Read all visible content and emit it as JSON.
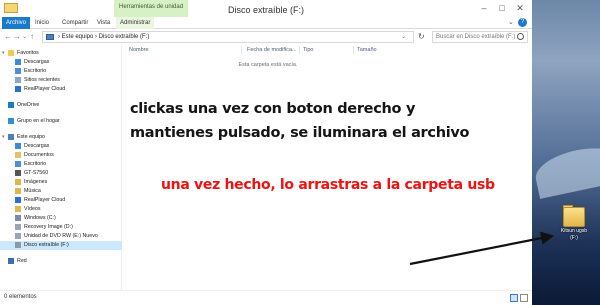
{
  "window": {
    "title": "Disco extraíble (F:)",
    "tools_group_label": "Herramientas de unidad"
  },
  "ribbon": {
    "tabs": [
      {
        "label": "Archivo"
      },
      {
        "label": "Inicio"
      },
      {
        "label": "Compartir"
      },
      {
        "label": "Vista"
      },
      {
        "label": "Administrar"
      }
    ]
  },
  "address": {
    "path": "›  Este equipo  ›  Disco extraíble (F:)",
    "search_placeholder": "Buscar en Disco extraíble (F:)"
  },
  "nav_pane": {
    "groups": [
      {
        "label": "Favoritos",
        "icon": "star-icon",
        "items": [
          {
            "label": "Descargas",
            "icon": "download-folder-icon"
          },
          {
            "label": "Escritorio",
            "icon": "desktop-folder-icon"
          },
          {
            "label": "Sitios recientes",
            "icon": "recent-places-icon"
          },
          {
            "label": "RealPlayer Cloud",
            "icon": "realplayer-icon"
          }
        ]
      },
      {
        "label": "OneDrive",
        "icon": "cloud-icon",
        "items": []
      },
      {
        "label": "Grupo en el hogar",
        "icon": "homegroup-icon",
        "items": []
      },
      {
        "label": "Este equipo",
        "icon": "pc-icon",
        "items": [
          {
            "label": "Descargas",
            "icon": "download-folder-icon"
          },
          {
            "label": "Documentos",
            "icon": "documents-folder-icon"
          },
          {
            "label": "Escritorio",
            "icon": "desktop-folder-icon"
          },
          {
            "label": "GT-S7560",
            "icon": "phone-icon"
          },
          {
            "label": "Imágenes",
            "icon": "pictures-folder-icon"
          },
          {
            "label": "Música",
            "icon": "music-folder-icon"
          },
          {
            "label": "RealPlayer Cloud",
            "icon": "realplayer-icon"
          },
          {
            "label": "Vídeos",
            "icon": "videos-folder-icon"
          },
          {
            "label": "Windows (C:)",
            "icon": "drive-c-icon"
          },
          {
            "label": "Recovery Image (D:)",
            "icon": "drive-icon"
          },
          {
            "label": "Unidad de DVD RW (E:) Nuevo",
            "icon": "dvd-drive-icon"
          },
          {
            "label": "Disco extraíble (F:)",
            "icon": "usb-drive-icon",
            "selected": true
          }
        ]
      },
      {
        "label": "Red",
        "icon": "network-icon",
        "items": []
      }
    ]
  },
  "content": {
    "columns": [
      "Nombre",
      "Fecha de modifica...",
      "Tipo",
      "Tamaño"
    ],
    "empty_message": "Esta carpeta está vacía."
  },
  "annotations": {
    "line1": "clickas una vez con boton derecho y",
    "line2": "mantienes pulsado, se iluminara el archivo",
    "instruction2": "una vez hecho, lo arrastras a la carpeta usb",
    "instruction2_color": "#ee1212"
  },
  "statusbar": {
    "count": "0 elementos"
  },
  "desktop": {
    "usb_folder_label": "Kitsun ugsb (F:)"
  },
  "colors": {
    "accent": "#1979ca",
    "tools_tab": "#d8f0c5",
    "selected_nav": "#cce8ff"
  }
}
